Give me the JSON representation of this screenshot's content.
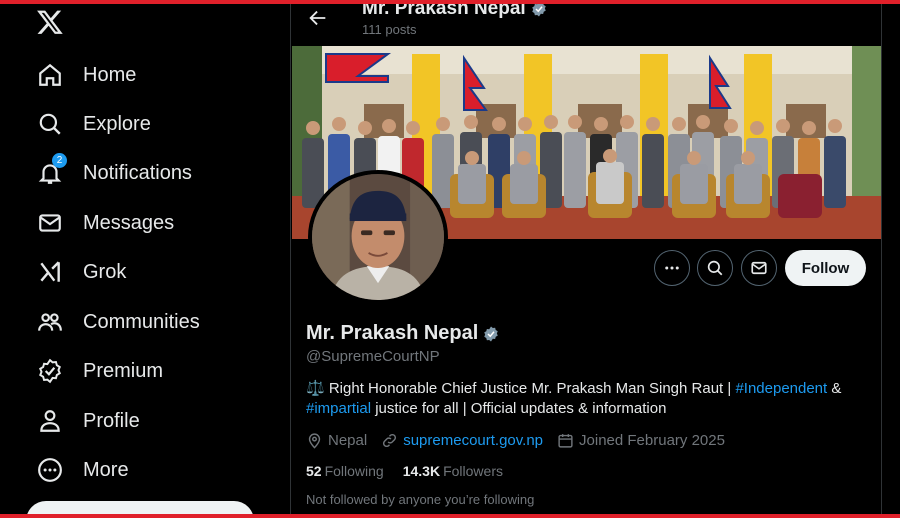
{
  "sidebar": {
    "logo_icon": "x-logo",
    "items": [
      {
        "label": "Home",
        "icon": "home-icon"
      },
      {
        "label": "Explore",
        "icon": "search-icon"
      },
      {
        "label": "Notifications",
        "icon": "bell-icon",
        "badge": "2"
      },
      {
        "label": "Messages",
        "icon": "envelope-icon"
      },
      {
        "label": "Grok",
        "icon": "grok-icon"
      },
      {
        "label": "Communities",
        "icon": "people-icon"
      },
      {
        "label": "Premium",
        "icon": "verified-outline-icon"
      },
      {
        "label": "Profile",
        "icon": "person-icon"
      },
      {
        "label": "More",
        "icon": "more-circle-icon"
      }
    ]
  },
  "header": {
    "name": "Mr. Prakash Nepal",
    "posts_count": "111 posts"
  },
  "profile": {
    "name": "Mr. Prakash Nepal",
    "handle": "@SupremeCourtNP",
    "bio": {
      "part1": "⚖️ Right Honorable Chief Justice Mr. Prakash Man Singh Raut | ",
      "tag1": "#Independent",
      "part2": " &",
      "tag2": "#impartial",
      "part3": " justice for all | Official updates & information"
    },
    "location": "Nepal",
    "website": "supremecourt.gov.np",
    "joined": "Joined February 2025",
    "following_count": "52",
    "following_label": "Following",
    "followers_count": "14.3K",
    "followers_label": "Followers",
    "followed_by_text": "Not followed by anyone you’re following"
  },
  "actions": {
    "follow_label": "Follow"
  },
  "colors": {
    "accent": "#1d9bf0",
    "background": "#000000",
    "frame_red": "#e0202a"
  }
}
